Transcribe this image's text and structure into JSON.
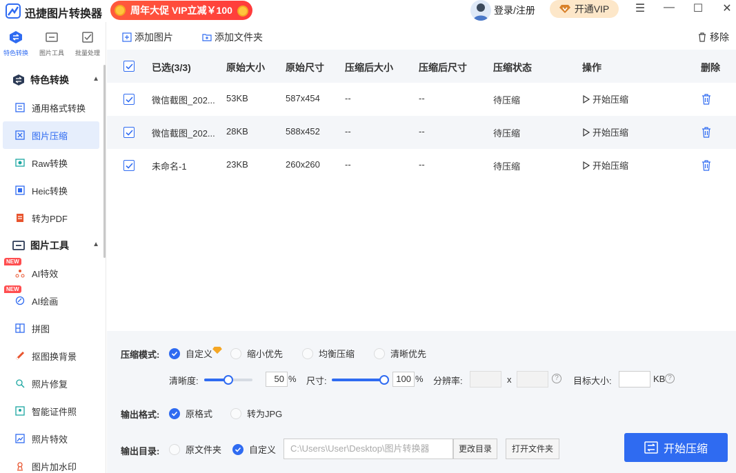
{
  "titlebar": {
    "app_title": "迅捷图片转换器",
    "promo": "周年大促 VIP立减￥100",
    "login": "登录/注册",
    "vip": "开通VIP"
  },
  "sidebar": {
    "topnav": [
      {
        "label": "特色转换",
        "icon": "swap-icon",
        "active": true
      },
      {
        "label": "图片工具",
        "icon": "image-tool-icon",
        "active": false
      },
      {
        "label": "批量处理",
        "icon": "batch-check-icon",
        "active": false
      }
    ],
    "section1": {
      "title": "特色转换"
    },
    "section1_items": [
      {
        "label": "通用格式转换",
        "icon": "format-icon"
      },
      {
        "label": "图片压缩",
        "icon": "compress-icon",
        "active": true
      },
      {
        "label": "Raw转换",
        "icon": "raw-icon"
      },
      {
        "label": "Heic转换",
        "icon": "heic-icon"
      },
      {
        "label": "转为PDF",
        "icon": "pdf-icon"
      }
    ],
    "section2": {
      "title": "图片工具"
    },
    "section2_items": [
      {
        "label": "AI特效",
        "icon": "ai-effect-icon",
        "badge": "NEW"
      },
      {
        "label": "AI绘画",
        "icon": "ai-paint-icon",
        "badge": "NEW"
      },
      {
        "label": "拼图",
        "icon": "collage-icon"
      },
      {
        "label": "抠图换背景",
        "icon": "cutout-icon"
      },
      {
        "label": "照片修复",
        "icon": "repair-icon"
      },
      {
        "label": "智能证件照",
        "icon": "id-photo-icon"
      },
      {
        "label": "照片特效",
        "icon": "photo-effect-icon"
      },
      {
        "label": "图片加水印",
        "icon": "watermark-icon"
      }
    ]
  },
  "toolbar": {
    "add_image": "添加图片",
    "add_folder": "添加文件夹",
    "remove": "移除"
  },
  "table": {
    "headers": {
      "selected": "已选(3/3)",
      "orig_size": "原始大小",
      "orig_dim": "原始尺寸",
      "new_size": "压缩后大小",
      "new_dim": "压缩后尺寸",
      "status": "压缩状态",
      "action": "操作",
      "delete": "删除"
    },
    "rows": [
      {
        "name": "微信截图_202...",
        "orig_size": "53KB",
        "orig_dim": "587x454",
        "new_size": "--",
        "new_dim": "--",
        "status": "待压缩",
        "action": "开始压缩"
      },
      {
        "name": "微信截图_202...",
        "orig_size": "28KB",
        "orig_dim": "588x452",
        "new_size": "--",
        "new_dim": "--",
        "status": "待压缩",
        "action": "开始压缩"
      },
      {
        "name": "未命名-1",
        "orig_size": "23KB",
        "orig_dim": "260x260",
        "new_size": "--",
        "new_dim": "--",
        "status": "待压缩",
        "action": "开始压缩"
      }
    ]
  },
  "settings": {
    "mode_label": "压缩模式:",
    "modes": [
      "自定义",
      "缩小优先",
      "均衡压缩",
      "清晰优先"
    ],
    "clarity_label": "清晰度:",
    "clarity_value": "50",
    "clarity_pct": 0.5,
    "percent": "%",
    "size_label": "尺寸:",
    "size_value": "100",
    "size_pct": 1.0,
    "resolution_label": "分辨率:",
    "x": "x",
    "target_label": "目标大小:",
    "kb": "KB",
    "help": "?",
    "format_label": "输出格式:",
    "formats": [
      "原格式",
      "转为JPG"
    ],
    "dir_label": "输出目录:",
    "dirs": [
      "原文件夹",
      "自定义"
    ],
    "path": "C:\\Users\\User\\Desktop\\图片转换器",
    "change_dir": "更改目录",
    "open_folder": "打开文件夹",
    "start": "开始压缩"
  },
  "colors": {
    "accent": "#2f6bf1",
    "promo": "#ff4a3a",
    "vip_bg": "#fde7c9"
  }
}
